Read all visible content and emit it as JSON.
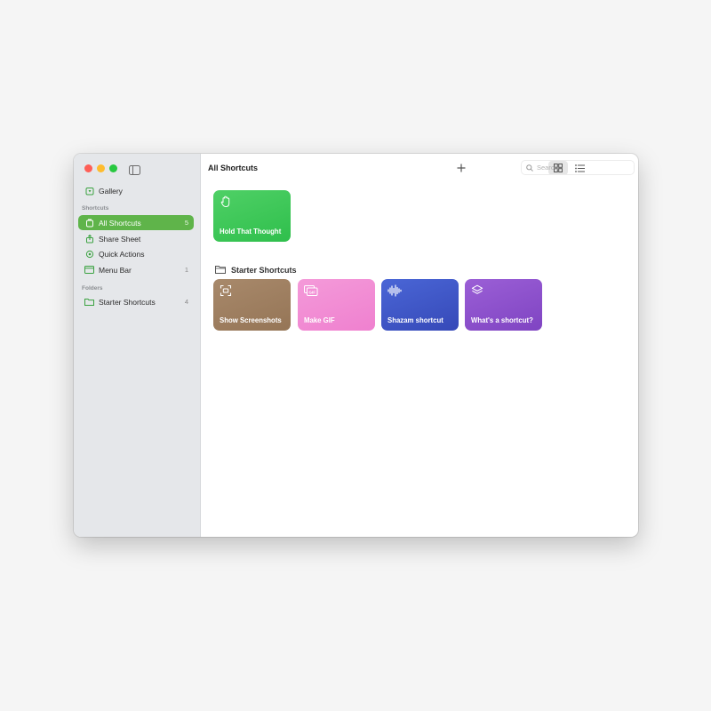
{
  "header": {
    "title": "All Shortcuts",
    "search_placeholder": "Search"
  },
  "sidebar": {
    "gallery": {
      "label": "Gallery",
      "icon": "gallery-icon"
    },
    "shortcuts_header": "Shortcuts",
    "items": [
      {
        "label": "All Shortcuts",
        "count": "5",
        "icon": "all-shortcuts-icon",
        "active": true
      },
      {
        "label": "Share Sheet",
        "count": "",
        "icon": "share-icon"
      },
      {
        "label": "Quick Actions",
        "count": "",
        "icon": "gear-icon"
      },
      {
        "label": "Menu Bar",
        "count": "1",
        "icon": "menu-bar-icon"
      }
    ],
    "folders_header": "Folders",
    "folders": [
      {
        "label": "Starter Shortcuts",
        "count": "4",
        "icon": "folder-icon"
      }
    ]
  },
  "main": {
    "top_card": {
      "label": "Hold That Thought",
      "icon": "hand-icon",
      "color": "#3dc657"
    },
    "folder_title": "Starter Shortcuts",
    "cards": [
      {
        "label": "Show Screenshots",
        "icon": "screenshot-icon",
        "color": "#9f7f60"
      },
      {
        "label": "Make GIF",
        "icon": "gif-icon",
        "color": "#f28ed5"
      },
      {
        "label": "Shazam shortcut",
        "icon": "waveform-icon",
        "color": "#3f57c7"
      },
      {
        "label": "What's a shortcut?",
        "icon": "layers-icon",
        "color": "#8c50cc"
      }
    ]
  },
  "colors": {
    "accent": "#5fb44a",
    "sidebar_bg": "#e5e7ea",
    "page_bg": "#f5f5f5"
  }
}
